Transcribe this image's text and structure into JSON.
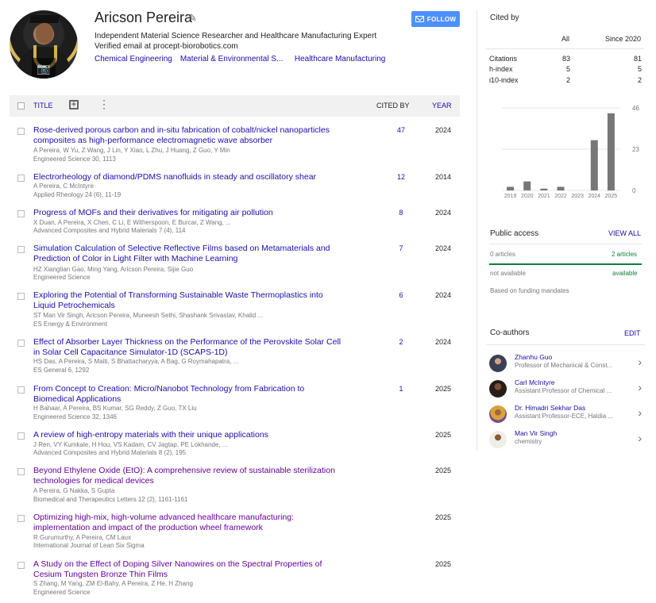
{
  "profile": {
    "name": "Aricson Pereira",
    "affiliation": "Independent Material Science Researcher and Healthcare Manufacturing Expert",
    "email": "Verified email at procept-biorobotics.com",
    "interests": [
      "Chemical Engineering",
      "Material & Environmental S...",
      "Healthcare Manufacturing"
    ],
    "follow_label": "FOLLOW"
  },
  "table": {
    "title_header": "TITLE",
    "cited_by_header": "CITED BY",
    "year_header": "YEAR"
  },
  "articles": [
    {
      "title": "Rose-derived porous carbon and in-situ fabrication of cobalt/nickel nanoparticles composites as high-performance electromagnetic wave absorber",
      "authors": "A Pereira, W Yu, Z Wang, J Lin, Y Xiao, L Zhu, J Huang, Z Guo, Y Min",
      "source": "Engineered Science 30, 1113",
      "cited": "47",
      "year": "2024"
    },
    {
      "title": "Electrorheology of diamond/PDMS nanofluids in steady and oscillatory shear",
      "authors": "A Pereira, C McIntyre",
      "source": "Applied Rheology 24 (6), 11-19",
      "cited": "12",
      "year": "2014"
    },
    {
      "title": "Progress of MOFs and their derivatives for mitigating air pollution",
      "authors": "X Duan, A Pereira, X Chen, C Li, E Witherspoon, E Burcar, Z Wang, ...",
      "source": "Advanced Composites and Hybrid Materials 7 (4), 114",
      "cited": "8",
      "year": "2024"
    },
    {
      "title": "Simulation Calculation of Selective Reflective Films based on Metamaterials and Prediction of Color in Light Filter with Machine Learning",
      "authors": "HZ Xiangtian Gao, Ming Yang, Aricson Pereira, Sijie Guo",
      "source": "Engineered Science",
      "cited": "7",
      "year": "2024"
    },
    {
      "title": "Exploring the Potential of Transforming Sustainable Waste Thermoplastics into Liquid Petrochemicals",
      "authors": "ST Man Vir Singh, Aricson Pereira, Muneesh Sethi, Shashank Srivastav, Khalid ...",
      "source": "ES Energy & Environment",
      "cited": "6",
      "year": "2024"
    },
    {
      "title": "Effect of Absorber Layer Thickness on the Performance of the Perovskite Solar Cell in Solar Cell Capacitance Simulator-1D (SCAPS-1D)",
      "authors": "HS Das, A Pereira, S Maiti, S Bhattacharyya, A Bag, G Roymahapatra, ...",
      "source": "ES General 6, 1292",
      "cited": "2",
      "year": "2024"
    },
    {
      "title": "From Concept to Creation: Micro/Nanobot Technology from Fabrication to Biomedical Applications",
      "authors": "H Bahaar, A Pereira, BS Kumar, SG Reddy, Z Guo, TX Liu",
      "source": "Engineered Science 32, 1346",
      "cited": "1",
      "year": "2025"
    },
    {
      "title": "A review of high-entropy materials with their unique applications",
      "authors": "J Ren, VY Kumkale, H Hou, VS Kadam, CV Jagtap, PE Lokhande, ...",
      "source": "Advanced Composites and Hybrid Materials 8 (2), 195",
      "cited": "",
      "year": "2025"
    },
    {
      "title": "Beyond Ethylene Oxide (EtO): A comprehensive review of sustainable sterilization technologies for medical devices",
      "authors": "A Pereira, G Nakka, S Gupta",
      "source": "Biomedical and Therapeutics Letters 12 (2), 1161-1161",
      "cited": "",
      "year": "2025"
    },
    {
      "title": "Optimizing high-mix, high-volume advanced healthcare manufacturing: implementation and impact of the production wheel framework",
      "authors": "R Gurumurthy, A Pereira, CM Laux",
      "source": "International Journal of Lean Six Sigma",
      "cited": "",
      "year": "2025"
    },
    {
      "title": "A Study on the Effect of Doping Silver Nanowires on the Spectral Properties of Cesium Tungsten Bronze Thin Films",
      "authors": "S Zhang, M Yang, ZM El-Bahy, A Pereira, Z He, H Zhang",
      "source": "Engineered Science",
      "cited": "",
      "year": "2025"
    }
  ],
  "cited_by": {
    "title": "Cited by",
    "col_all": "All",
    "col_since": "Since 2020",
    "metrics": [
      {
        "label": "Citations",
        "all": "83",
        "since": "81"
      },
      {
        "label": "h-index",
        "all": "5",
        "since": "5"
      },
      {
        "label": "i10-index",
        "all": "2",
        "since": "2"
      }
    ]
  },
  "chart_data": {
    "type": "bar",
    "categories": [
      "2019",
      "2020",
      "2021",
      "2022",
      "2023",
      "2024",
      "2025"
    ],
    "values": [
      2,
      5,
      1,
      2,
      0,
      28,
      43
    ],
    "ylim": [
      0,
      46
    ],
    "y_ticks": [
      "46",
      "23",
      "0"
    ],
    "bar_color": "#777777"
  },
  "public_access": {
    "title": "Public access",
    "view_all": "VIEW ALL",
    "not_available_count": "0 articles",
    "available_count": "2 articles",
    "not_available_label": "not available",
    "available_label": "available",
    "note": "Based on funding mandates"
  },
  "coauthors": {
    "title": "Co-authors",
    "edit": "EDIT",
    "list": [
      {
        "name": "Zhanhu Guo",
        "affiliation": "Professor of Mechanical & Const..."
      },
      {
        "name": "Carl McIntyre",
        "affiliation": "Assistant Professor of Chemical ..."
      },
      {
        "name": "Dr. Himadri Sekhar Das",
        "affiliation": "Assistant Professor-ECE, Haldia ..."
      },
      {
        "name": "Man Vir Singh",
        "affiliation": "chemistry"
      }
    ]
  },
  "colors": {
    "link": "#1a0dab",
    "visited": "#660099",
    "green": "#0f7b3e",
    "follow": "#4d90fe"
  }
}
